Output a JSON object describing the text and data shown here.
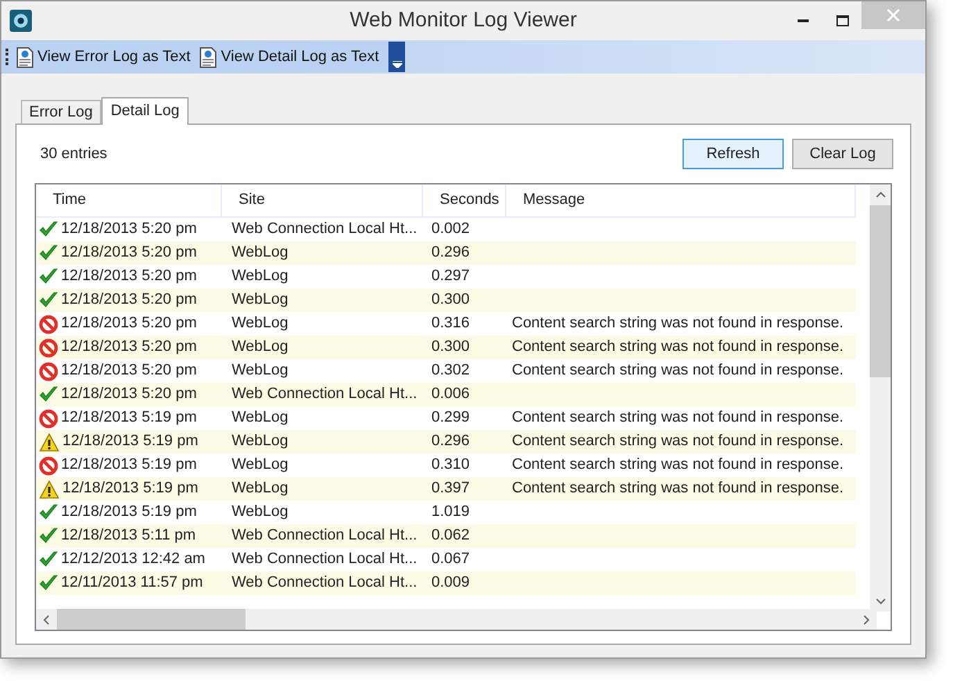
{
  "window": {
    "title": "Web Monitor Log Viewer"
  },
  "toolbar": {
    "buttons": [
      "View Error Log as Text",
      "View Detail Log as Text"
    ]
  },
  "tabs": [
    {
      "label": "Error Log",
      "selected": false
    },
    {
      "label": "Detail Log",
      "selected": true
    }
  ],
  "entry_count": "30 entries",
  "buttons": [
    {
      "label": "Refresh",
      "hovered": true
    },
    {
      "label": "Clear Log",
      "hovered": false
    }
  ],
  "table": {
    "columns": [
      "Time",
      "Site",
      "Seconds",
      "Message"
    ],
    "rows": [
      {
        "kind": "ok",
        "time": "12/18/2013 5:20 pm",
        "site": "Web Connection Local Ht...",
        "seconds": "0.002"
      },
      {
        "kind": "ok",
        "time": "12/18/2013 5:20 pm",
        "site": "WebLog",
        "seconds": "0.296"
      },
      {
        "kind": "ok",
        "time": "12/18/2013 5:20 pm",
        "site": "WebLog",
        "seconds": "0.297"
      },
      {
        "kind": "ok",
        "time": "12/18/2013 5:20 pm",
        "site": "WebLog",
        "seconds": "0.300"
      },
      {
        "kind": "error",
        "time": "12/18/2013 5:20 pm",
        "site": "WebLog",
        "seconds": "0.316",
        "message": "Content search string was not found in response."
      },
      {
        "kind": "error",
        "time": "12/18/2013 5:20 pm",
        "site": "WebLog",
        "seconds": "0.300",
        "message": "Content search string was not found in response."
      },
      {
        "kind": "error",
        "time": "12/18/2013 5:20 pm",
        "site": "WebLog",
        "seconds": "0.302",
        "message": "Content search string was not found in response."
      },
      {
        "kind": "ok",
        "time": "12/18/2013 5:20 pm",
        "site": "Web Connection Local Ht...",
        "seconds": "0.006"
      },
      {
        "kind": "error",
        "time": "12/18/2013 5:19 pm",
        "site": "WebLog",
        "seconds": "0.299",
        "message": "Content search string was not found in response."
      },
      {
        "kind": "warning",
        "time": "12/18/2013 5:19 pm",
        "site": "WebLog",
        "seconds": "0.296",
        "message": "Content search string was not found in response."
      },
      {
        "kind": "error",
        "time": "12/18/2013 5:19 pm",
        "site": "WebLog",
        "seconds": "0.310",
        "message": "Content search string was not found in response."
      },
      {
        "kind": "warning",
        "time": "12/18/2013 5:19 pm",
        "site": "WebLog",
        "seconds": "0.397",
        "message": "Content search string was not found in response."
      },
      {
        "kind": "ok",
        "time": "12/18/2013 5:19 pm",
        "site": "WebLog",
        "seconds": "1.019"
      },
      {
        "kind": "ok",
        "time": "12/18/2013 5:11 pm",
        "site": "Web Connection Local Ht...",
        "seconds": "0.062"
      },
      {
        "kind": "ok",
        "time": "12/12/2013 12:42 am",
        "site": "Web Connection Local Ht...",
        "seconds": "0.067"
      },
      {
        "kind": "ok",
        "time": "12/11/2013 11:57 pm",
        "site": "Web Connection Local Ht...",
        "seconds": "0.009"
      }
    ]
  }
}
